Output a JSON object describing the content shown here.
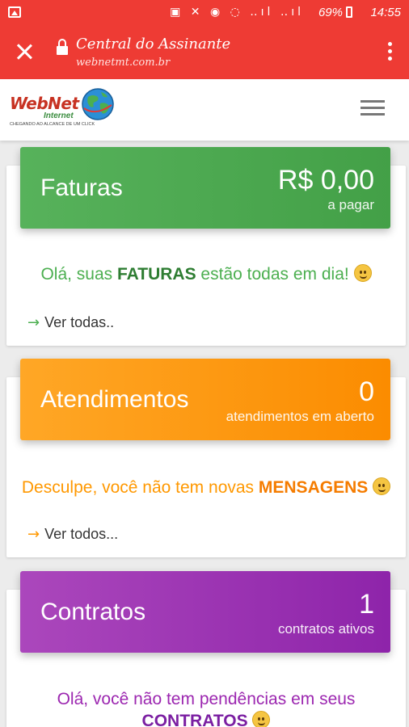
{
  "status_bar": {
    "icons": "▣ ✕ ◉ ◌ ‥ıl ‥ıl",
    "battery": "69%",
    "time": "14:55"
  },
  "browser": {
    "title": "Central do Assinante",
    "url": "webnetmt.com.br"
  },
  "logo": {
    "name": "WebNet",
    "sub": "Internet",
    "slogan": "CHEGANDO AO ALCANCE DE UM CLICK"
  },
  "cards": {
    "faturas": {
      "title": "Faturas",
      "value": "R$ 0,00",
      "value_label": "a pagar",
      "message_pre": "Olá, suas ",
      "message_strong": "FATURAS",
      "message_post": " estão todas em dia! ",
      "link": "Ver todas..",
      "color": "#4caf50"
    },
    "atendimentos": {
      "title": "Atendimentos",
      "value": "0",
      "value_label": "atendimentos em aberto",
      "message_pre": "Desculpe, você não tem novas ",
      "message_strong": "MENSAGENS",
      "message_post": " ",
      "link": "Ver todos...",
      "color": "#ff9800"
    },
    "contratos": {
      "title": "Contratos",
      "value": "1",
      "value_label": "contratos ativos",
      "message_pre": "Olá, você não tem pendências em seus",
      "message_strong": "CONTRATOS",
      "message_post": " ",
      "color": "#9c27b0"
    }
  }
}
